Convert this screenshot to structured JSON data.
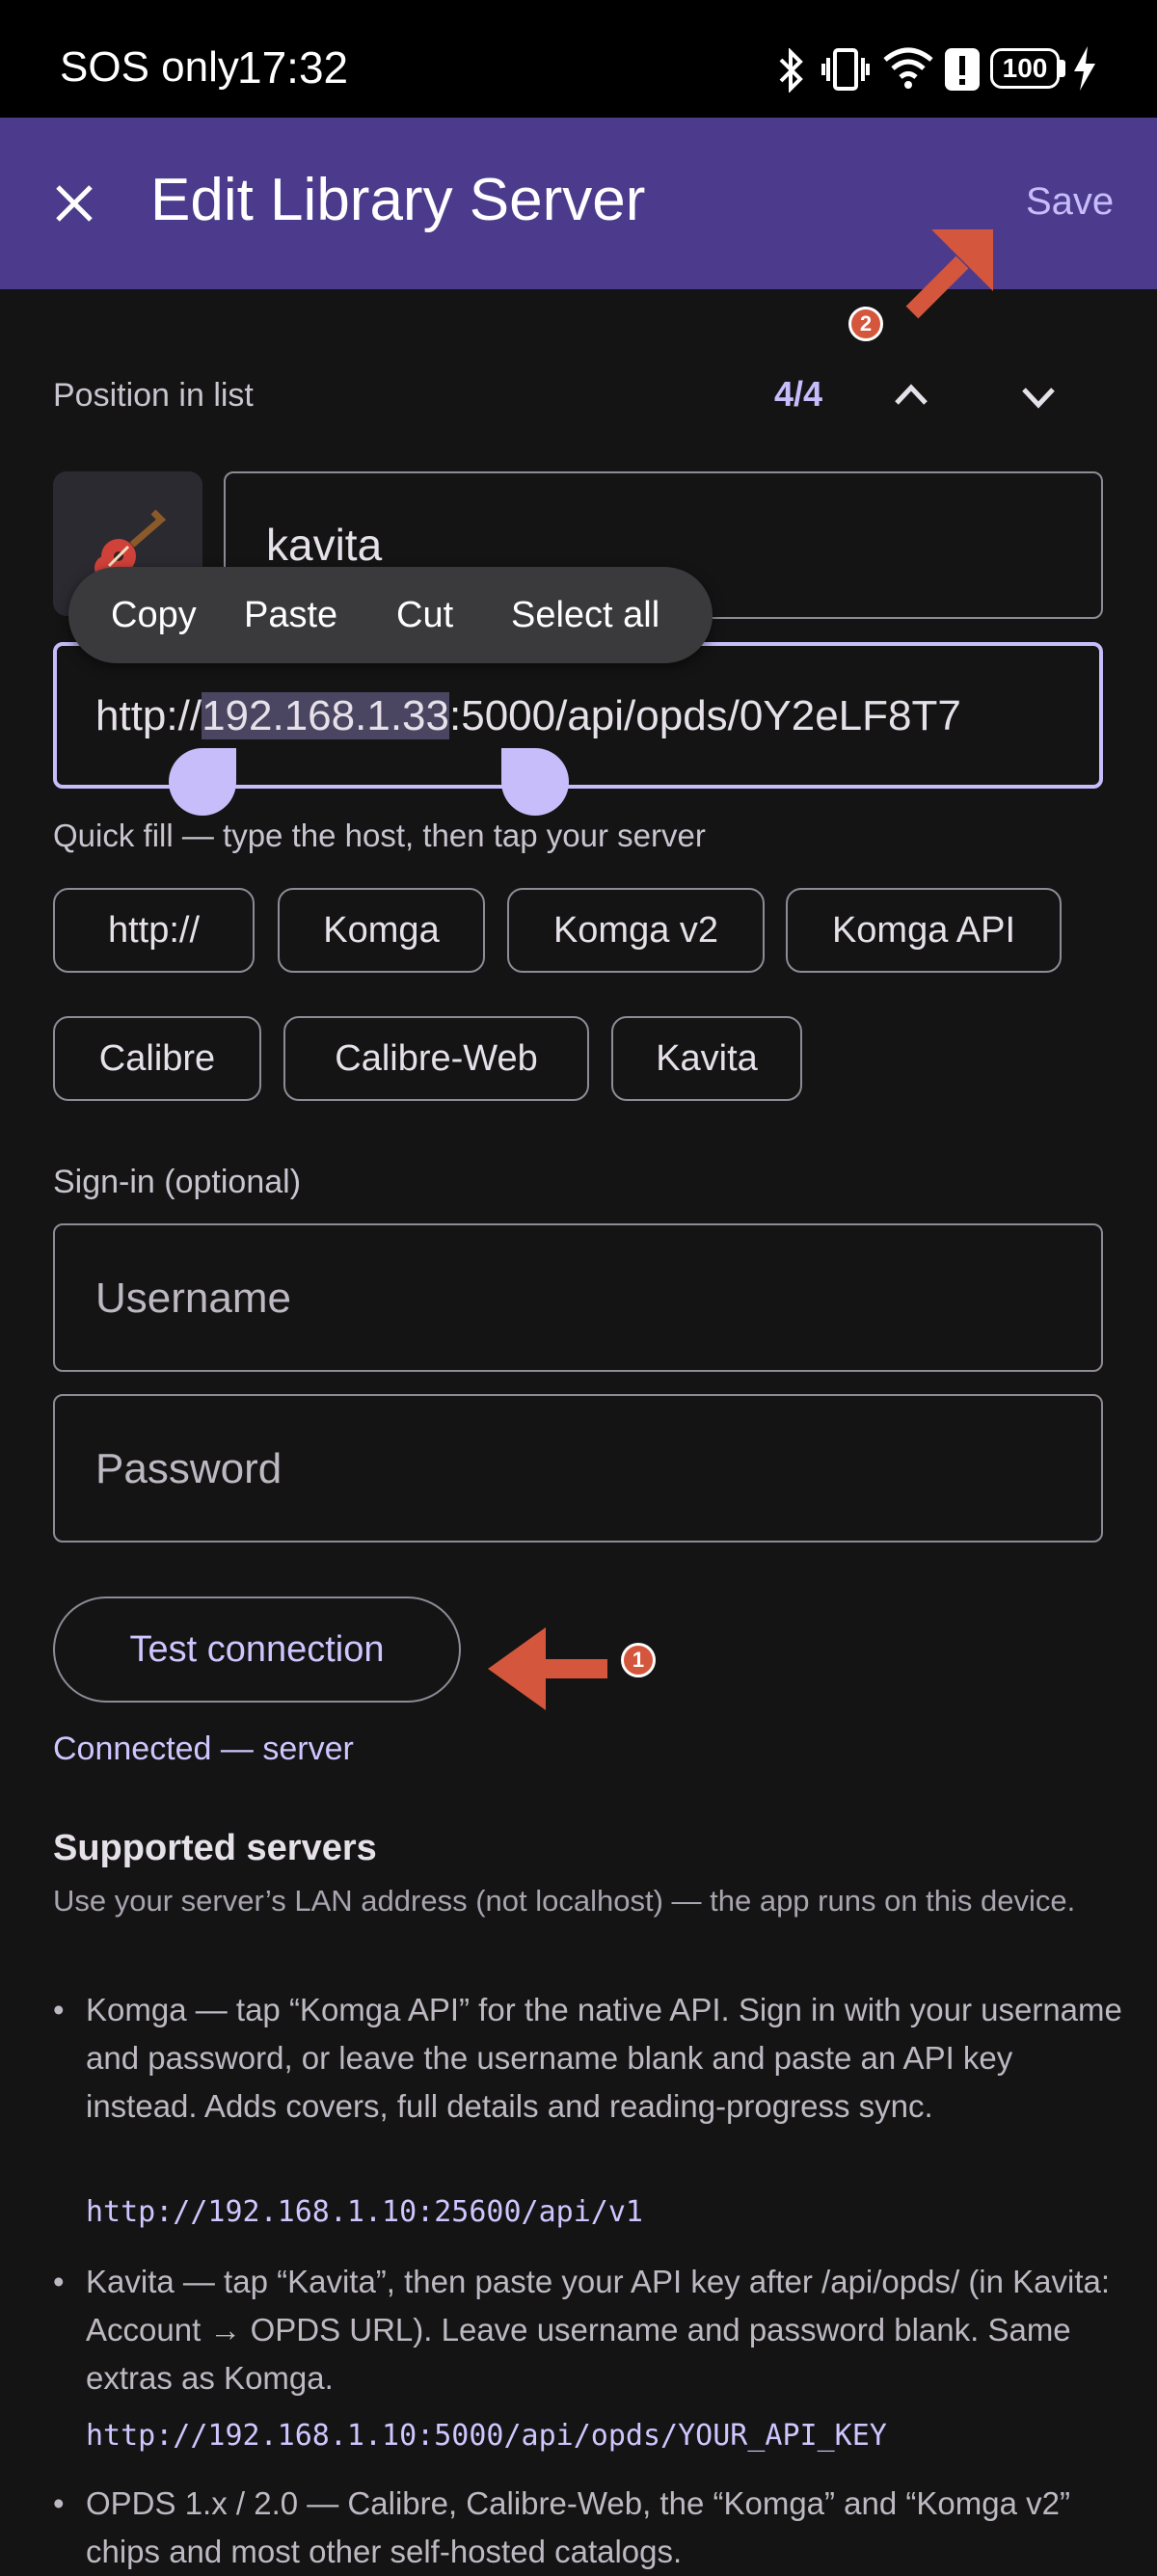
{
  "status_bar": {
    "carrier": "SOS only",
    "time": "17:32",
    "battery": "100",
    "icons": [
      "bluetooth-icon",
      "vibrate-icon",
      "wifi-icon",
      "alert-icon",
      "battery-icon",
      "charging-icon"
    ]
  },
  "app_bar": {
    "close_icon": "close-icon",
    "title": "Edit Library Server",
    "save_label": "Save"
  },
  "position": {
    "label": "Position in list",
    "value": "4/4",
    "up_icon": "chevron-up-icon",
    "down_icon": "chevron-down-icon"
  },
  "server": {
    "icon": "guitar-icon",
    "name_value": "kavita",
    "url_prefix": "http://",
    "url_selected": "192.168.1.33",
    "url_suffix": ":5000/api/opds/0Y2eLF8T7"
  },
  "context_menu": {
    "copy": "Copy",
    "paste": "Paste",
    "cut": "Cut",
    "select_all": "Select all"
  },
  "quick_fill": {
    "label": "Quick fill — type the host, then tap your server",
    "chips": [
      "http://",
      "Komga",
      "Komga v2",
      "Komga API",
      "Calibre",
      "Calibre-Web",
      "Kavita"
    ]
  },
  "signin": {
    "label": "Sign-in (optional)",
    "username_placeholder": "Username",
    "password_placeholder": "Password"
  },
  "test": {
    "button_label": "Test connection",
    "status": "Connected — server"
  },
  "annotations": {
    "badge1": "1",
    "badge2": "2",
    "accent": "#d4573d"
  },
  "supported": {
    "title": "Supported servers",
    "intro": "Use your server’s LAN address (not localhost) — the app runs on this device.",
    "items": [
      {
        "text": "Komga — tap “Komga API” for the native API. Sign in with your username and password, or leave the username blank and paste an API key instead. Adds covers, full details and reading-progress sync.",
        "url": "http://192.168.1.10:25600/api/v1"
      },
      {
        "text": "Kavita — tap “Kavita”, then paste your API key after /api/opds/ (in Kavita: Account → OPDS URL). Leave username and password blank. Same extras as Komga.",
        "url": "http://192.168.1.10:5000/api/opds/YOUR_API_KEY"
      },
      {
        "text": "OPDS 1.x / 2.0 — Calibre, Calibre-Web, the “Komga” and “Komga v2” chips and most other self-hosted catalogs."
      }
    ]
  },
  "colors": {
    "app_bar": "#4c3b8c",
    "accent_text": "#cfc6ff",
    "background": "#141414",
    "selection": "#4a4560",
    "handle": "#c8bdfb"
  }
}
